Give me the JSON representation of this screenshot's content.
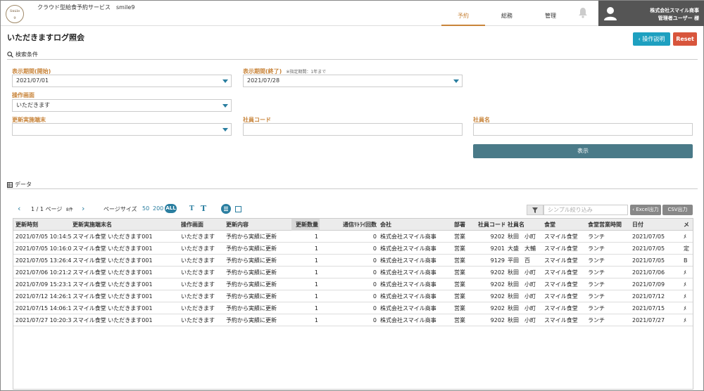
{
  "header": {
    "logo_text": [
      "Smile",
      "9"
    ],
    "app_title": "クラウド型給食予約サービス　smile9",
    "nav": [
      {
        "label": "予約",
        "active": true
      },
      {
        "label": "総務",
        "active": false
      },
      {
        "label": "管理",
        "active": false
      }
    ],
    "user_company": "株式会社スマイル商事",
    "user_name": "管理者ユーザー 様"
  },
  "page": {
    "title": "いただきますログ照会",
    "help_button": "‹ 操作説明",
    "reset_button": "Reset"
  },
  "search": {
    "section_label": "検索条件",
    "start_label": "表示期間(開始)",
    "start_value": "2021/07/01",
    "end_label": "表示期間(終了)",
    "end_note": "※指定期間：1年まで",
    "end_value": "2021/07/28",
    "screen_label": "操作画面",
    "screen_value": "いただきます",
    "terminal_label": "更新実施端末",
    "terminal_value": "",
    "emp_code_label": "社員コード",
    "emp_name_label": "社員名",
    "show_button": "表示"
  },
  "data_section": {
    "label": "データ",
    "pager_text": "1 / 1 ページ",
    "count_text": "8件",
    "page_size_label": "ページサイズ",
    "size_50": "50",
    "size_200": "200",
    "size_all": "ALL",
    "font_small": "T",
    "font_large": "T",
    "filter_placeholder": "シンプル絞り込み",
    "excel_button": "‹ Excel出力",
    "csv_button": "CSV出力"
  },
  "table": {
    "columns": [
      "更新時刻",
      "更新実施端末名",
      "操作画面",
      "更新内容",
      "更新数量",
      "通信ﾘﾄﾗｲ回数",
      "会社",
      "部署",
      "社員コード",
      "社員名",
      "食堂",
      "食堂営業時間",
      "日付",
      "メ"
    ],
    "rows": [
      [
        "2021/07/05 10:14:57",
        "スマイル食堂 いただきます001",
        "いただきます",
        "予約から実績に更新",
        "1",
        "0",
        "株式会社スマイル商事",
        "営業",
        "9202",
        "秋田　小町",
        "スマイル食堂",
        "ランチ",
        "2021/07/05",
        "ﾒ"
      ],
      [
        "2021/07/05 10:16:05",
        "スマイル食堂 いただきます001",
        "いただきます",
        "予約から実績に更新",
        "1",
        "0",
        "株式会社スマイル商事",
        "営業",
        "9201",
        "大盛　大輔",
        "スマイル食堂",
        "ランチ",
        "2021/07/05",
        "定"
      ],
      [
        "2021/07/05 13:26:49",
        "スマイル食堂 いただきます001",
        "いただきます",
        "予約から実績に更新",
        "1",
        "0",
        "株式会社スマイル商事",
        "営業",
        "9129",
        "平田　百",
        "スマイル食堂",
        "ランチ",
        "2021/07/05",
        "B"
      ],
      [
        "2021/07/06 10:21:26",
        "スマイル食堂 いただきます001",
        "いただきます",
        "予約から実績に更新",
        "1",
        "0",
        "株式会社スマイル商事",
        "営業",
        "9202",
        "秋田　小町",
        "スマイル食堂",
        "ランチ",
        "2021/07/06",
        "ﾒ"
      ],
      [
        "2021/07/09 15:23:10",
        "スマイル食堂 いただきます001",
        "いただきます",
        "予約から実績に更新",
        "1",
        "0",
        "株式会社スマイル商事",
        "営業",
        "9202",
        "秋田　小町",
        "スマイル食堂",
        "ランチ",
        "2021/07/09",
        "ﾒ"
      ],
      [
        "2021/07/12 14:26:16",
        "スマイル食堂 いただきます001",
        "いただきます",
        "予約から実績に更新",
        "1",
        "0",
        "株式会社スマイル商事",
        "営業",
        "9202",
        "秋田　小町",
        "スマイル食堂",
        "ランチ",
        "2021/07/12",
        "ﾒ"
      ],
      [
        "2021/07/15 14:06:12",
        "スマイル食堂 いただきます001",
        "いただきます",
        "予約から実績に更新",
        "1",
        "0",
        "株式会社スマイル商事",
        "営業",
        "9202",
        "秋田　小町",
        "スマイル食堂",
        "ランチ",
        "2021/07/15",
        "ﾒ"
      ],
      [
        "2021/07/27 10:20:30",
        "スマイル食堂 いただきます001",
        "いただきます",
        "予約から実績に更新",
        "1",
        "0",
        "株式会社スマイル商事",
        "営業",
        "9202",
        "秋田　小町",
        "スマイル食堂",
        "ランチ",
        "2021/07/27",
        "ﾒ"
      ]
    ]
  },
  "colors": {
    "accent": "#c8843a",
    "primary": "#2a7ea0",
    "help": "#1ea0c0",
    "reset": "#d8553c",
    "show_button": "#4a7a88"
  }
}
